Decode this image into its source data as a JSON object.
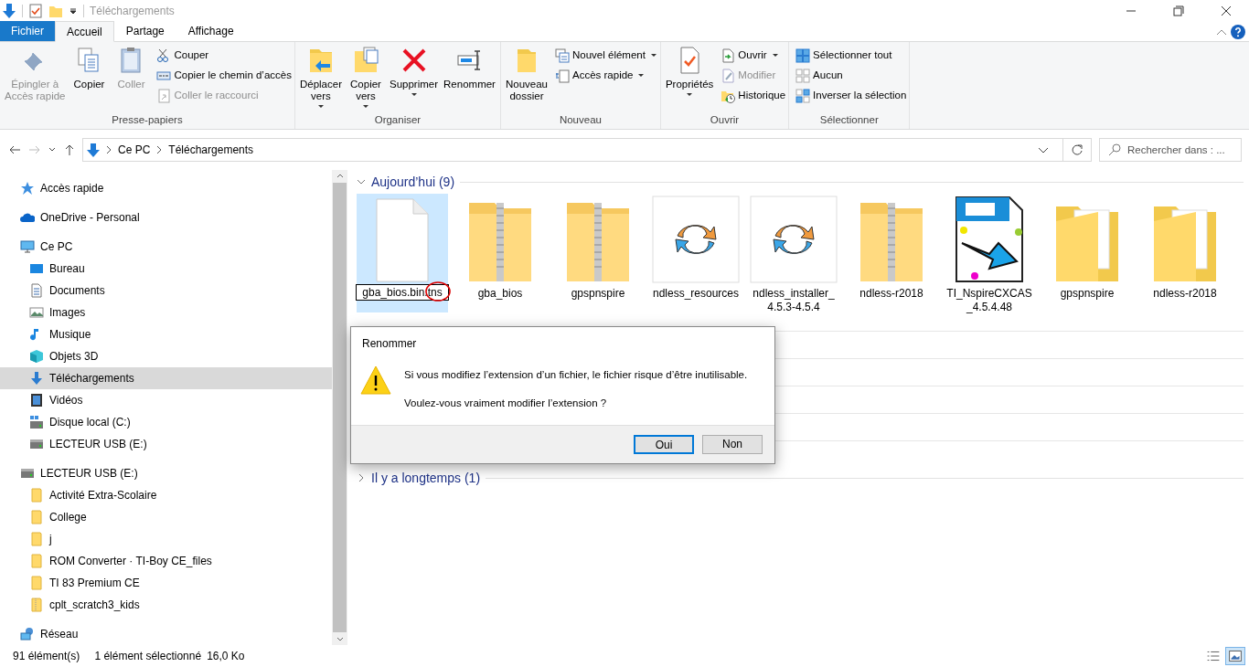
{
  "window": {
    "title": "Téléchargements"
  },
  "tabs": [
    {
      "label": "Fichier",
      "kind": "file",
      "selected": false
    },
    {
      "label": "Accueil",
      "kind": "tab",
      "selected": true
    },
    {
      "label": "Partage",
      "kind": "tab",
      "selected": false
    },
    {
      "label": "Affichage",
      "kind": "tab",
      "selected": false
    }
  ],
  "ribbon": {
    "groups": [
      {
        "label": "Presse-papiers",
        "items": [
          {
            "label": "Épingler à\nAccès rapide",
            "kind": "large",
            "disabled": true,
            "dropdown": false
          },
          {
            "label": "Copier",
            "kind": "large",
            "disabled": false,
            "dropdown": false
          },
          {
            "label": "Coller",
            "kind": "large",
            "disabled": true,
            "dropdown": false
          },
          {
            "label": "Couper",
            "kind": "small",
            "disabled": false,
            "dropdown": false
          },
          {
            "label": "Copier le chemin d’accès",
            "kind": "small",
            "disabled": false,
            "dropdown": false
          },
          {
            "label": "Coller le raccourci",
            "kind": "small",
            "disabled": true,
            "dropdown": false
          }
        ]
      },
      {
        "label": "Organiser",
        "items": [
          {
            "label": "Déplacer\nvers",
            "kind": "large",
            "disabled": false,
            "dropdown": true
          },
          {
            "label": "Copier\nvers",
            "kind": "large",
            "disabled": false,
            "dropdown": true
          },
          {
            "label": "Supprimer",
            "kind": "large",
            "disabled": false,
            "dropdown": true
          },
          {
            "label": "Renommer",
            "kind": "large",
            "disabled": false,
            "dropdown": false
          }
        ]
      },
      {
        "label": "Nouveau",
        "items": [
          {
            "label": "Nouveau\ndossier",
            "kind": "large",
            "disabled": false,
            "dropdown": false
          },
          {
            "label": "Nouvel élément",
            "kind": "small",
            "disabled": false,
            "dropdown": true
          },
          {
            "label": "Accès rapide",
            "kind": "small",
            "disabled": false,
            "dropdown": true
          }
        ]
      },
      {
        "label": "Ouvrir",
        "items": [
          {
            "label": "Propriétés",
            "kind": "large",
            "disabled": false,
            "dropdown": true
          },
          {
            "label": "Ouvrir",
            "kind": "small",
            "disabled": false,
            "dropdown": true
          },
          {
            "label": "Modifier",
            "kind": "small",
            "disabled": true,
            "dropdown": false
          },
          {
            "label": "Historique",
            "kind": "small",
            "disabled": false,
            "dropdown": false
          }
        ]
      },
      {
        "label": "Sélectionner",
        "items": [
          {
            "label": "Sélectionner tout",
            "kind": "small",
            "disabled": false,
            "dropdown": false
          },
          {
            "label": "Aucun",
            "kind": "small",
            "disabled": false,
            "dropdown": false
          },
          {
            "label": "Inverser la sélection",
            "kind": "small",
            "disabled": false,
            "dropdown": false
          }
        ]
      }
    ]
  },
  "address_bar": {
    "path": [
      "Ce PC",
      "Téléchargements"
    ]
  },
  "search": {
    "placeholder": "Rechercher dans : ..."
  },
  "sidebar": {
    "items": [
      {
        "label": "Accès rapide",
        "selected": false
      },
      {
        "label": "OneDrive - Personal",
        "selected": false
      },
      {
        "label": "Ce PC",
        "selected": false,
        "children": [
          {
            "label": "Bureau",
            "selected": false
          },
          {
            "label": "Documents",
            "selected": false
          },
          {
            "label": "Images",
            "selected": false
          },
          {
            "label": "Musique",
            "selected": false
          },
          {
            "label": "Objets 3D",
            "selected": false
          },
          {
            "label": "Téléchargements",
            "selected": true
          },
          {
            "label": "Vidéos",
            "selected": false
          },
          {
            "label": "Disque local (C:)",
            "selected": false
          },
          {
            "label": "LECTEUR USB (E:)",
            "selected": false
          }
        ]
      },
      {
        "label": "LECTEUR USB (E:)",
        "selected": false,
        "children": [
          {
            "label": "Activité Extra-Scolaire",
            "selected": false
          },
          {
            "label": "College",
            "selected": false
          },
          {
            "label": "j",
            "selected": false
          },
          {
            "label": "ROM Converter · TI-Boy CE_files",
            "selected": false
          },
          {
            "label": "TI 83 Premium CE",
            "selected": false
          },
          {
            "label": "cplt_scratch3_kids",
            "selected": false
          }
        ]
      },
      {
        "label": "Réseau",
        "selected": false
      }
    ]
  },
  "groups": [
    {
      "label": "Aujourd’hui (9)",
      "expanded": true,
      "items": [
        {
          "name": "gba_bios.bin.tns",
          "kind": "file",
          "selected": true,
          "renaming": true
        },
        {
          "name": "gba_bios",
          "kind": "zip",
          "selected": false,
          "renaming": false
        },
        {
          "name": "gpspnspire",
          "kind": "zip",
          "selected": false,
          "renaming": false
        },
        {
          "name": "ndless_resources",
          "kind": "installer",
          "selected": false,
          "renaming": false
        },
        {
          "name": "ndless_installer_4.5.3-4.5.4",
          "kind": "installer",
          "selected": false,
          "renaming": false
        },
        {
          "name": "ndless-r2018",
          "kind": "zip",
          "selected": false,
          "renaming": false
        },
        {
          "name": "TI_NspireCXCAS_4.5.4.48",
          "kind": "cas",
          "selected": false,
          "renaming": false
        },
        {
          "name": "gpspnspire",
          "kind": "folder",
          "selected": false,
          "renaming": false
        },
        {
          "name": "ndless-r2018",
          "kind": "folder",
          "selected": false,
          "renaming": false
        }
      ]
    },
    {
      "label": "Il y a longtemps (1)",
      "expanded": false
    }
  ],
  "dialog": {
    "title": "Renommer",
    "message": "Si vous modifiez l’extension d’un fichier, le fichier risque d’être inutilisable.",
    "question": "Voulez-vous vraiment modifier l’extension ?",
    "buttons": [
      {
        "label": "Oui",
        "selected": true
      },
      {
        "label": "Non",
        "selected": false
      }
    ]
  },
  "status_bar": {
    "count": "91 élément(s)",
    "selection": "1 élément sélectionné",
    "size": "16,0 Ko",
    "views": [
      {
        "selected": false
      },
      {
        "selected": true
      }
    ]
  }
}
